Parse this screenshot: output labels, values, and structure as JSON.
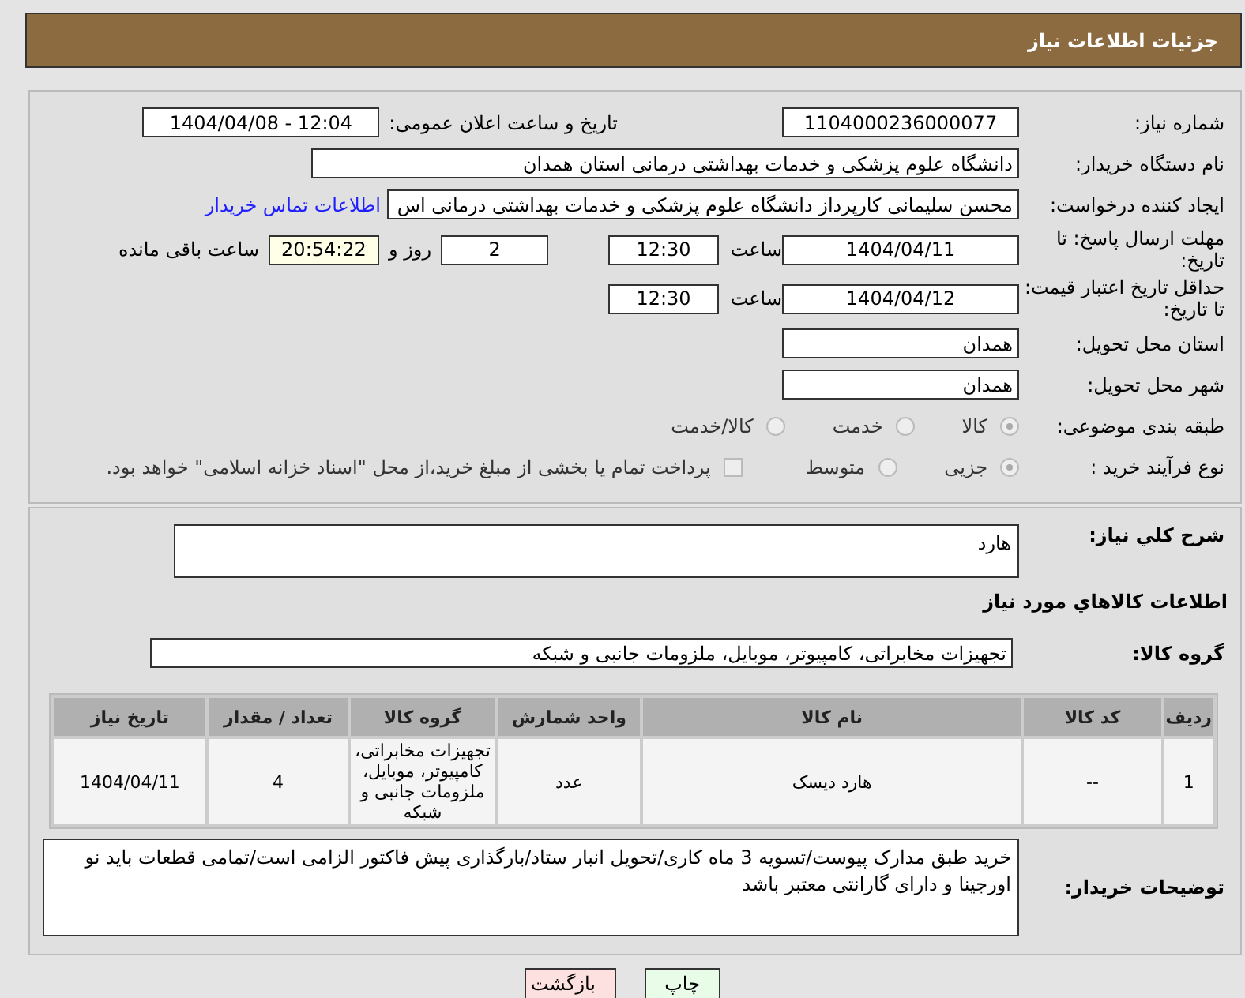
{
  "header": {
    "title": "جزئیات اطلاعات نیاز"
  },
  "info": {
    "need_number": {
      "label": "شماره نیاز:",
      "value": "1104000236000077"
    },
    "announce": {
      "label": "تاریخ و ساعت اعلان عمومی:",
      "value": "1404/04/08 - 12:04"
    },
    "buyer_org": {
      "label": "نام دستگاه خریدار:",
      "value": "دانشگاه علوم پزشکی و خدمات بهداشتی درمانی استان همدان"
    },
    "requester": {
      "label": "ایجاد کننده درخواست:",
      "value": "محسن سلیمانی کارپرداز دانشگاه علوم پزشکی و خدمات بهداشتی درمانی اس",
      "link": "اطلاعات تماس خریدار"
    },
    "deadline": {
      "label": "مهلت ارسال پاسخ: تا تاریخ:",
      "date": "1404/04/11",
      "time_label": "ساعت",
      "time": "12:30",
      "days": "2",
      "days_label": "روز و",
      "remaining": "20:54:22",
      "remaining_label": "ساعت باقی مانده"
    },
    "validity": {
      "label": "حداقل تاریخ اعتبار قیمت: تا تاریخ:",
      "date": "1404/04/12",
      "time_label": "ساعت",
      "time": "12:30"
    },
    "province": {
      "label": "استان محل تحویل:",
      "value": "همدان"
    },
    "city": {
      "label": "شهر محل تحویل:",
      "value": "همدان"
    },
    "category": {
      "label": "طبقه بندی موضوعی:",
      "options": [
        {
          "label": "کالا",
          "selected": true
        },
        {
          "label": "خدمت",
          "selected": false
        },
        {
          "label": "کالا/خدمت",
          "selected": false
        }
      ]
    },
    "process": {
      "label": "نوع فرآیند خرید :",
      "options": [
        {
          "label": "جزیی",
          "selected": true
        },
        {
          "label": "متوسط",
          "selected": false
        }
      ],
      "payment": {
        "label": "پرداخت تمام یا بخشی از مبلغ خرید،از محل \"اسناد خزانه اسلامی\" خواهد بود.",
        "checked": false
      }
    }
  },
  "details": {
    "description": {
      "label": "شرح کلي نياز:",
      "value": "هارد"
    },
    "goods_heading": "اطلاعات کالاهاي مورد نياز",
    "group": {
      "label": "گروه کالا:",
      "value": "تجهیزات مخابراتی، کامپیوتر، موبایل، ملزومات جانبی و شبکه"
    },
    "table": {
      "columns": [
        "ردیف",
        "کد کالا",
        "نام کالا",
        "واحد شمارش",
        "گروه کالا",
        "تعداد / مقدار",
        "تاریخ نیاز"
      ],
      "rows": [
        [
          "1",
          "--",
          "هارد دیسک",
          "عدد",
          "تجهیزات مخابراتی، کامپیوتر، موبایل، ملزومات جانبی و شبکه",
          "4",
          "1404/04/11"
        ]
      ]
    },
    "buyer_notes": {
      "label": "توضیحات خریدار:",
      "value": "خرید طبق مدارک پیوست/تسویه 3 ماه کاری/تحویل انبار ستاد/بارگذاری پیش فاکتور الزامی است/تمامی قطعات باید نو اورجینا و دارای گارانتی معتبر باشد"
    }
  },
  "buttons": [
    {
      "label": "چاپ",
      "kind": "print"
    },
    {
      "label": "بازگشت",
      "kind": "back"
    }
  ]
}
